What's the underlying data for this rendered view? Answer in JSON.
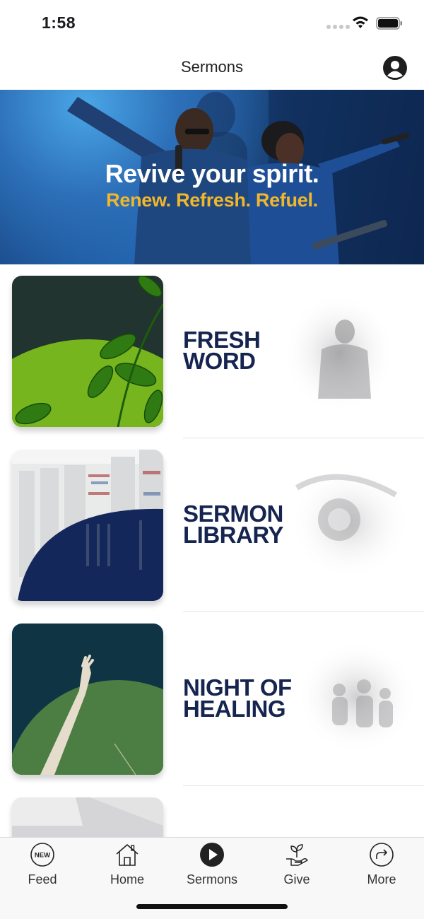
{
  "status_bar": {
    "time": "1:58"
  },
  "nav": {
    "title": "Sermons"
  },
  "hero": {
    "line1": "Revive your spirit.",
    "line2": "Renew. Refresh. Refuel."
  },
  "items": [
    {
      "title": "FRESH\nWORD"
    },
    {
      "title": "SERMON\nLIBRARY"
    },
    {
      "title": "NIGHT OF\nHEALING"
    },
    {
      "title": ""
    }
  ],
  "tabs": [
    {
      "label": "Feed",
      "icon": "new-badge-icon",
      "badge": "NEW"
    },
    {
      "label": "Home",
      "icon": "home-icon"
    },
    {
      "label": "Sermons",
      "icon": "play-circle-icon"
    },
    {
      "label": "Give",
      "icon": "give-plant-hand-icon"
    },
    {
      "label": "More",
      "icon": "share-arrow-icon"
    }
  ],
  "colors": {
    "title_navy": "#16254f",
    "hero_gold": "#f1b72b",
    "accent_green": "#7fbf1f"
  }
}
